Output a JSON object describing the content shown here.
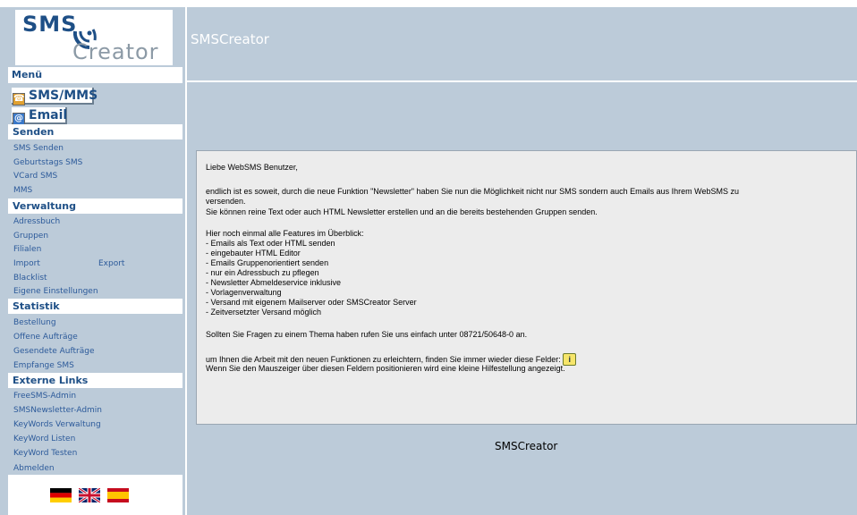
{
  "logo": {
    "line1": "SMS",
    "line2": "Creator"
  },
  "header": {
    "title": "SMSCreator"
  },
  "menu": {
    "label": "Menü"
  },
  "big_buttons": {
    "sms_mms": "SMS/MMS",
    "email": "Email"
  },
  "sections": {
    "senden": {
      "title": "Senden",
      "items": [
        "SMS Senden",
        "Geburtstags SMS",
        "VCard SMS",
        "MMS"
      ]
    },
    "verwaltung": {
      "title": "Verwaltung",
      "items": [
        "Adressbuch",
        "Gruppen",
        "Filialen",
        "Import",
        "Export",
        "Blacklist",
        "Eigene Einstellungen"
      ]
    },
    "statistik": {
      "title": "Statistik",
      "items": [
        "Bestellung",
        "Offene Aufträge",
        "Gesendete Aufträge",
        "Empfange SMS"
      ]
    },
    "externe": {
      "title": "Externe Links",
      "items": [
        "FreeSMS-Admin",
        "SMSNewsletter-Admin",
        "KeyWords Verwaltung",
        "KeyWord Listen",
        "KeyWord Testen"
      ]
    }
  },
  "logout": "Abmelden",
  "content": {
    "greeting": "Liebe WebSMS Benutzer,",
    "para1_l1": "endlich ist es soweit, durch die neue Funktion \"Newsletter\" haben Sie nun die Möglichkeit nicht nur SMS sondern auch Emails aus Ihrem WebSMS zu",
    "para1_l2": "versenden.",
    "para1_l3": "Sie können reine Text oder auch HTML Newsletter erstellen und an die bereits bestehenden Gruppen senden.",
    "features_title": "Hier noch einmal alle Features im Überblick:",
    "features": [
      "- Emails als Text oder HTML senden",
      "- eingebauter HTML Editor",
      "- Emails Gruppenorientiert senden",
      "- nur ein Adressbuch zu pflegen",
      "- Newsletter Abmeldeservice inklusive",
      "- Vorlagenverwaltung",
      "- Versand mit eigenem Mailserver oder SMSCreator Server",
      "- Zeitversetzter Versand möglich"
    ],
    "questions": "Sollten Sie Fragen zu einem Thema haben rufen Sie uns einfach unter 08721/50648-0 an.",
    "help_l1": "um Ihnen die Arbeit mit den neuen Funktionen zu erleichtern, finden Sie immer wieder diese Felder:",
    "help_l2": "Wenn Sie den Mauszeiger über diesen Feldern positionieren wird eine kleine Hilfestellung angezeigt."
  },
  "footer": {
    "title": "SMSCreator"
  },
  "icons": {
    "info": "info-icon",
    "sms": "phone-icon",
    "email": "at-icon"
  },
  "colors": {
    "panel": "#bccbd9",
    "link": "#2c5a9a",
    "heading": "#1e4f86"
  }
}
